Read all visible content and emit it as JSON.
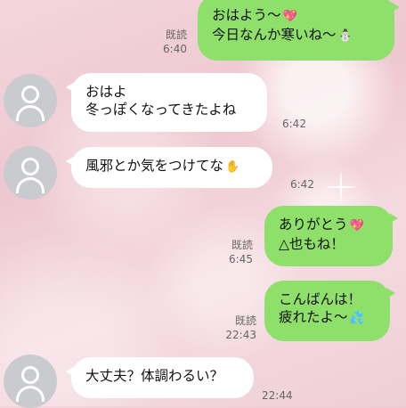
{
  "messages": [
    {
      "side": "right",
      "lines": [
        "おはよう〜",
        "今日なんか寒いね〜"
      ],
      "emoji": [
        "💖",
        "⛄"
      ],
      "read": "既読",
      "time": "6:40"
    },
    {
      "side": "left",
      "lines": [
        "おはよ",
        "冬っぽくなってきたよね"
      ],
      "time": "6:42"
    },
    {
      "side": "left",
      "lines": [
        "風邪とか気をつけてな"
      ],
      "emoji": [
        "✋"
      ],
      "time": "6:42"
    },
    {
      "side": "right",
      "lines": [
        "ありがとう",
        "△也もね！"
      ],
      "emoji": [
        "💖"
      ],
      "read": "既読",
      "time": "6:45"
    },
    {
      "side": "right",
      "lines": [
        "こんばんは！",
        "疲れたよ〜"
      ],
      "emoji": [
        "💦"
      ],
      "read": "既読",
      "time": "22:43"
    },
    {
      "side": "left",
      "lines": [
        "大丈夫？体調わるい？"
      ],
      "time": "22:44"
    }
  ],
  "colors": {
    "sent_bubble": "#8fe06b",
    "received_bubble": "#ffffff",
    "avatar_bg": "#c9cbcf"
  }
}
